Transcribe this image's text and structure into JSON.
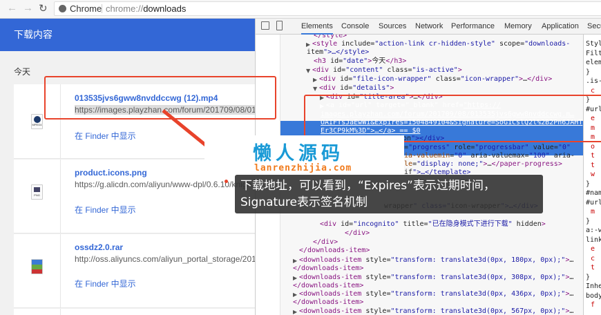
{
  "browser": {
    "brand": "Chrome",
    "url_prefix": "chrome://",
    "url_path": "downloads"
  },
  "page": {
    "header": "下载内容",
    "date_label": "今天",
    "items": [
      {
        "file_name": "013535jvs6gww8nvddccwg (12).mp4",
        "url": "https://images.playzhan.com/forum/201709/08/0135",
        "action": "在 Finder 中显示",
        "icon": "mpeg4-file-icon",
        "icon_text": "MPEG4"
      },
      {
        "file_name": "product.icons.png",
        "url": "https://g.alicdn.com/aliyun/www-dpl/0.6.10/knigh",
        "action": "在 Finder 中显示",
        "icon": "png-file-icon",
        "icon_text": "PNG"
      },
      {
        "file_name": "ossdz2.0.rar",
        "url": "http://oss.aliyuncs.com/aliyun_portal_storage/2012/o",
        "action": "在 Finder 中显示",
        "icon": "rar-file-icon",
        "icon_text": ""
      }
    ]
  },
  "devtools": {
    "tabs": [
      "Elements",
      "Console",
      "Sources",
      "Network",
      "Performance",
      "Memory",
      "Application",
      "Secu"
    ],
    "active_tab": "Elements",
    "ellipsis": "...",
    "lines": [
      {
        "text": "</style>",
        "arrow": ""
      },
      {
        "text": "<style include=\"action-link cr-hidden-style\" scope=\"downloads-",
        "arrow": "▶"
      },
      {
        "text": "item\">…</style>",
        "arrow": ""
      },
      {
        "text": "<h3 id=\"date\">今天</h3>",
        "arrow": ""
      },
      {
        "text": "<div id=\"content\" class=\"is-active\">",
        "arrow": "▼"
      },
      {
        "text": "<div id=\"file-icon-wrapper\" class=\"icon-wrapper\">…</div>",
        "arrow": "▶"
      },
      {
        "text": "<div id=\"details\">",
        "arrow": "▼"
      },
      {
        "text": "<div id=\"title-area\">…</div>",
        "arrow": "▶"
      },
      {
        "text": "<a id=\"url\" target=\"_blank\" href=\"https://",
        "arrow": "▶",
        "selected": true
      },
      {
        "text": "images.playzhan.com/forum/201709/08/013535jvs6gww8nvddccwg.m…",
        "arrow": "",
        "selected": true
      },
      {
        "text": "OAIFTsJaEwWi&Expires=1504849104&Signature=SoG1CslQ2l%2B2Pn6JAHT",
        "arrow": "",
        "selected": true
      },
      {
        "text": "Er3CP9kM%3D\">…</a> == $0",
        "arrow": "",
        "selected": true
      },
      {
        "text": "ion\"></div>",
        "arrow": ""
      },
      {
        "text": "d=\"progress\" role=\"progressbar\" value=\"0\"",
        "arrow": ""
      },
      {
        "text": "ria-valuemin=\"0\" aria-valuemax=\"100\" aria-",
        "arrow": ""
      },
      {
        "text": "yle=\"display: none;\">…</paper-progress>",
        "arrow": ""
      },
      {
        "text": "-if\">…</template>",
        "arrow": ""
      },
      {
        "text": "wrapper\" class=\"icon-wrapper\">…</div>",
        "arrow": ""
      },
      {
        "text": "<div id=\"incognito\" title=\"已在隐身模式下进行下载\" hidden>",
        "arrow": ""
      },
      {
        "text": "</div>",
        "arrow": ""
      },
      {
        "text": "</div>",
        "arrow": ""
      },
      {
        "text": "</downloads-item>",
        "arrow": ""
      },
      {
        "text": "<downloads-item style=\"transform: translate3d(0px, 180px, 0px);\">…",
        "arrow": "▶"
      },
      {
        "text": "</downloads-item>",
        "arrow": ""
      },
      {
        "text": "<downloads-item style=\"transform: translate3d(0px, 308px, 0px);\">…",
        "arrow": "▶"
      },
      {
        "text": "</downloads-item>",
        "arrow": ""
      },
      {
        "text": "<downloads-item style=\"transform: translate3d(0px, 436px, 0px);\">…",
        "arrow": "▶"
      },
      {
        "text": "</downloads-item>",
        "arrow": ""
      },
      {
        "text": "<downloads-item style=\"transform: translate3d(0px, 567px, 0px);\">…",
        "arrow": "▶"
      },
      {
        "text": "</downloads-item>",
        "arrow": ""
      }
    ],
    "styles_lines": [
      [
        "Styl",
        ""
      ],
      [
        "Filter",
        ""
      ],
      [
        "elem",
        ""
      ],
      [
        "}",
        ""
      ],
      [
        ".is-",
        ""
      ],
      [
        "c",
        "r"
      ],
      [
        "}",
        ""
      ],
      [
        "#url",
        ""
      ],
      [
        "e",
        "r"
      ],
      [
        "m",
        "r"
      ],
      [
        "m",
        "r"
      ],
      [
        "o",
        "r"
      ],
      [
        "t",
        "r"
      ],
      [
        "t",
        "r"
      ],
      [
        "w",
        "r"
      ],
      [
        "}",
        ""
      ],
      [
        "#nam",
        ""
      ],
      [
        "#url",
        ""
      ],
      [
        "m",
        "r"
      ],
      [
        "}",
        ""
      ],
      [
        "a:-w",
        ""
      ],
      [
        "link",
        ""
      ],
      [
        "e",
        "r"
      ],
      [
        "c",
        "r"
      ],
      [
        "t",
        "r"
      ],
      [
        "}",
        ""
      ],
      [
        "Inher",
        ""
      ],
      [
        "body",
        ""
      ],
      [
        "f",
        "r"
      ]
    ]
  },
  "overlay": {
    "watermark_cn": "懒人源码",
    "watermark_en": "lanrenzhijia.com",
    "caption_line1": "下载地址，可以看到，“Expires”表示过期时间，",
    "caption_line2": "Signature表示签名机制"
  },
  "colors": {
    "accent": "#3367d6",
    "selection": "#3879d9",
    "annotation": "#e8432b"
  }
}
